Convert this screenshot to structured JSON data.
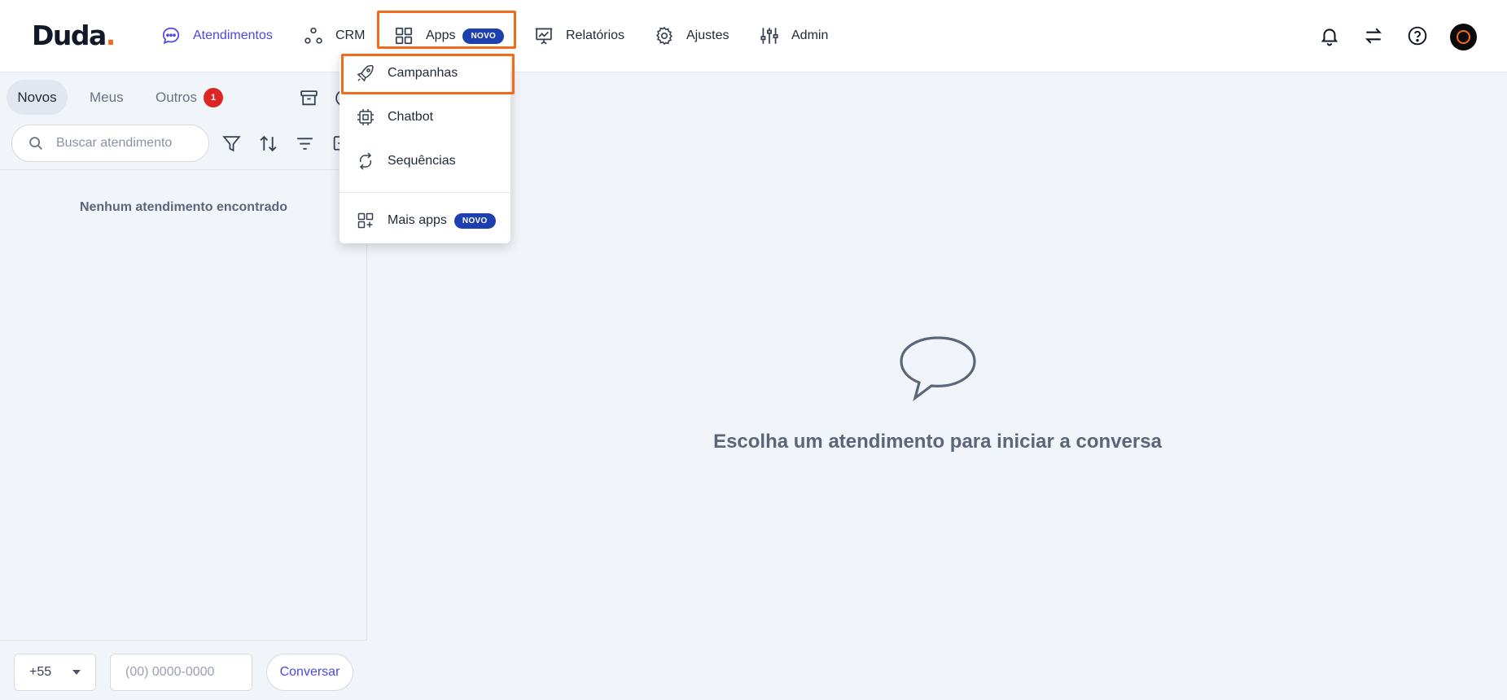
{
  "brand": {
    "name": "Duda",
    "dot": "."
  },
  "nav": {
    "items": [
      {
        "label": "Atendimentos",
        "icon": "chat-bubble-icon"
      },
      {
        "label": "CRM",
        "icon": "crm-nodes-icon"
      },
      {
        "label": "Apps",
        "icon": "apps-grid-icon",
        "badge": "NOVO"
      },
      {
        "label": "Relatórios",
        "icon": "presentation-chart-icon"
      },
      {
        "label": "Ajustes",
        "icon": "gear-icon"
      },
      {
        "label": "Admin",
        "icon": "sliders-icon"
      }
    ]
  },
  "header_icons": [
    "bell-icon",
    "swap-arrows-icon",
    "help-icon",
    "avatar"
  ],
  "apps_menu": {
    "items": [
      {
        "label": "Campanhas",
        "icon": "rocket-icon"
      },
      {
        "label": "Chatbot",
        "icon": "chip-icon"
      },
      {
        "label": "Sequências",
        "icon": "loop-icon"
      },
      {
        "label": "Mais apps",
        "icon": "apps-plus-icon",
        "badge": "NOVO"
      }
    ]
  },
  "sidebar": {
    "tabs": [
      {
        "label": "Novos"
      },
      {
        "label": "Meus"
      },
      {
        "label": "Outros",
        "count": "1"
      }
    ],
    "search": {
      "placeholder": "Buscar atendimento"
    },
    "empty_text": "Nenhum atendimento encontrado",
    "footer": {
      "country_code": "+55",
      "phone_placeholder": "(00) 0000-0000",
      "button": "Conversar"
    }
  },
  "main": {
    "empty_message": "Escolha um atendimento para iniciar a conversa"
  },
  "colors": {
    "accent": "#4f46e5",
    "badge": "#1e40af",
    "highlight": "#f26b1d",
    "alert": "#dc2626"
  }
}
